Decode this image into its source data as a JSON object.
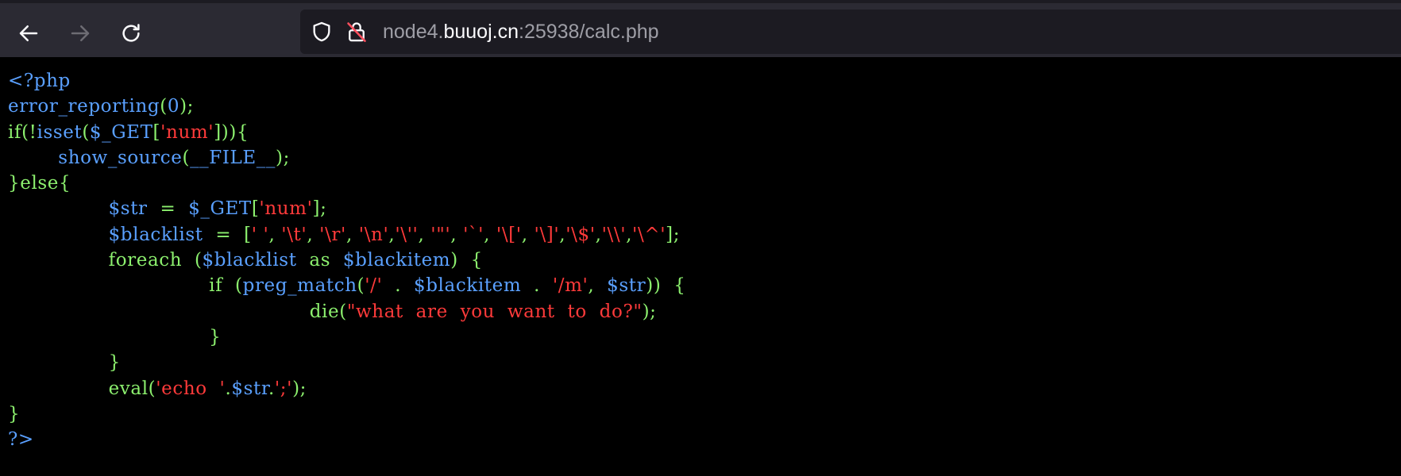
{
  "browser": {
    "back_icon": "arrow-left-icon",
    "forward_icon": "arrow-right-icon",
    "reload_icon": "reload-icon",
    "tracking_icon": "shield-icon",
    "insecure_icon": "lock-insecure-icon",
    "url_prefix": "node4.",
    "url_host": "buuoj.cn",
    "url_suffix": ":25938/calc.php"
  },
  "source_lines": [
    [
      {
        "c": "d",
        "t": "<?php"
      }
    ],
    [
      {
        "c": "d",
        "t": "error_reporting"
      },
      {
        "c": "g",
        "t": "("
      },
      {
        "c": "d",
        "t": "0"
      },
      {
        "c": "g",
        "t": ");"
      }
    ],
    [
      {
        "c": "g",
        "t": "if(!"
      },
      {
        "c": "d",
        "t": "isset"
      },
      {
        "c": "g",
        "t": "("
      },
      {
        "c": "d",
        "t": "$_GET"
      },
      {
        "c": "g",
        "t": "["
      },
      {
        "c": "r",
        "t": "'num'"
      },
      {
        "c": "g",
        "t": "])){"
      }
    ],
    [
      {
        "c": "g",
        "t": "        "
      },
      {
        "c": "d",
        "t": "show_source"
      },
      {
        "c": "g",
        "t": "("
      },
      {
        "c": "d",
        "t": "__FILE__"
      },
      {
        "c": "g",
        "t": ");"
      }
    ],
    [
      {
        "c": "g",
        "t": "}else{"
      }
    ],
    [
      {
        "c": "g",
        "t": "                "
      },
      {
        "c": "d",
        "t": "$str "
      },
      {
        "c": "g",
        "t": " = "
      },
      {
        "c": "d",
        "t": " $_GET"
      },
      {
        "c": "g",
        "t": "["
      },
      {
        "c": "r",
        "t": "'num'"
      },
      {
        "c": "g",
        "t": "];"
      }
    ],
    [
      {
        "c": "g",
        "t": "                "
      },
      {
        "c": "d",
        "t": "$blacklist "
      },
      {
        "c": "g",
        "t": " = "
      },
      {
        "c": "g",
        "t": " ["
      },
      {
        "c": "r",
        "t": "' '"
      },
      {
        "c": "g",
        "t": ", "
      },
      {
        "c": "r",
        "t": "'\\t'"
      },
      {
        "c": "g",
        "t": ", "
      },
      {
        "c": "r",
        "t": "'\\r'"
      },
      {
        "c": "g",
        "t": ", "
      },
      {
        "c": "r",
        "t": "'\\n'"
      },
      {
        "c": "g",
        "t": ","
      },
      {
        "c": "r",
        "t": "'\\''"
      },
      {
        "c": "g",
        "t": ", "
      },
      {
        "c": "r",
        "t": "'\"'"
      },
      {
        "c": "g",
        "t": ", "
      },
      {
        "c": "r",
        "t": "'`'"
      },
      {
        "c": "g",
        "t": ", "
      },
      {
        "c": "r",
        "t": "'\\['"
      },
      {
        "c": "g",
        "t": ", "
      },
      {
        "c": "r",
        "t": "'\\]'"
      },
      {
        "c": "g",
        "t": ","
      },
      {
        "c": "r",
        "t": "'\\$'"
      },
      {
        "c": "g",
        "t": ","
      },
      {
        "c": "r",
        "t": "'\\\\'"
      },
      {
        "c": "g",
        "t": ","
      },
      {
        "c": "r",
        "t": "'\\^'"
      },
      {
        "c": "g",
        "t": "];"
      }
    ],
    [
      {
        "c": "g",
        "t": "                "
      },
      {
        "c": "g",
        "t": "foreach "
      },
      {
        "c": "g",
        "t": " ("
      },
      {
        "c": "d",
        "t": "$blacklist "
      },
      {
        "c": "g",
        "t": " as "
      },
      {
        "c": "d",
        "t": " $blackitem"
      },
      {
        "c": "g",
        "t": ")  {"
      }
    ],
    [
      {
        "c": "g",
        "t": "                                "
      },
      {
        "c": "g",
        "t": "if "
      },
      {
        "c": "g",
        "t": " ("
      },
      {
        "c": "d",
        "t": "preg_match"
      },
      {
        "c": "g",
        "t": "("
      },
      {
        "c": "r",
        "t": "'/'"
      },
      {
        "c": "g",
        "t": "  . "
      },
      {
        "c": "d",
        "t": " $blackitem "
      },
      {
        "c": "g",
        "t": " . "
      },
      {
        "c": "r",
        "t": " '/m'"
      },
      {
        "c": "g",
        "t": ", "
      },
      {
        "c": "d",
        "t": " $str"
      },
      {
        "c": "g",
        "t": "))  {"
      }
    ],
    [
      {
        "c": "g",
        "t": "                                                "
      },
      {
        "c": "g",
        "t": "die("
      },
      {
        "c": "r",
        "t": "\"what  are  you  want  to  do?\""
      },
      {
        "c": "g",
        "t": ");"
      }
    ],
    [
      {
        "c": "g",
        "t": "                                "
      },
      {
        "c": "g",
        "t": "}"
      }
    ],
    [
      {
        "c": "g",
        "t": "                "
      },
      {
        "c": "g",
        "t": "}"
      }
    ],
    [
      {
        "c": "g",
        "t": "                "
      },
      {
        "c": "g",
        "t": "eval("
      },
      {
        "c": "r",
        "t": "'echo  '"
      },
      {
        "c": "g",
        "t": "."
      },
      {
        "c": "d",
        "t": "$str"
      },
      {
        "c": "g",
        "t": "."
      },
      {
        "c": "r",
        "t": "';'"
      },
      {
        "c": "g",
        "t": ");"
      }
    ],
    [
      {
        "c": "g",
        "t": "}"
      }
    ],
    [
      {
        "c": "d",
        "t": "?>"
      }
    ]
  ]
}
